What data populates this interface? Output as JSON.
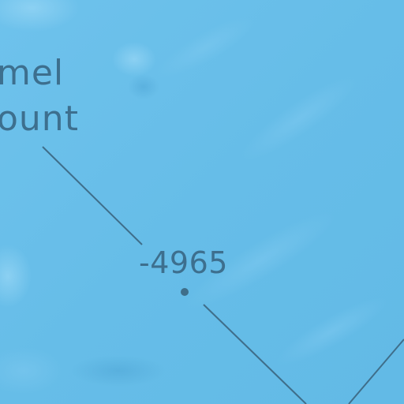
{
  "map": {
    "colors": {
      "water": "#66bde8",
      "water_light": "#86cdf1",
      "water_dark": "#56b0de",
      "label_text": "#3d6f8e",
      "contour_line": "#3f6e8a"
    },
    "seamount_label": {
      "lines": [
        "mel",
        "ount"
      ]
    },
    "depth_sounding": {
      "value": "-4965"
    }
  }
}
